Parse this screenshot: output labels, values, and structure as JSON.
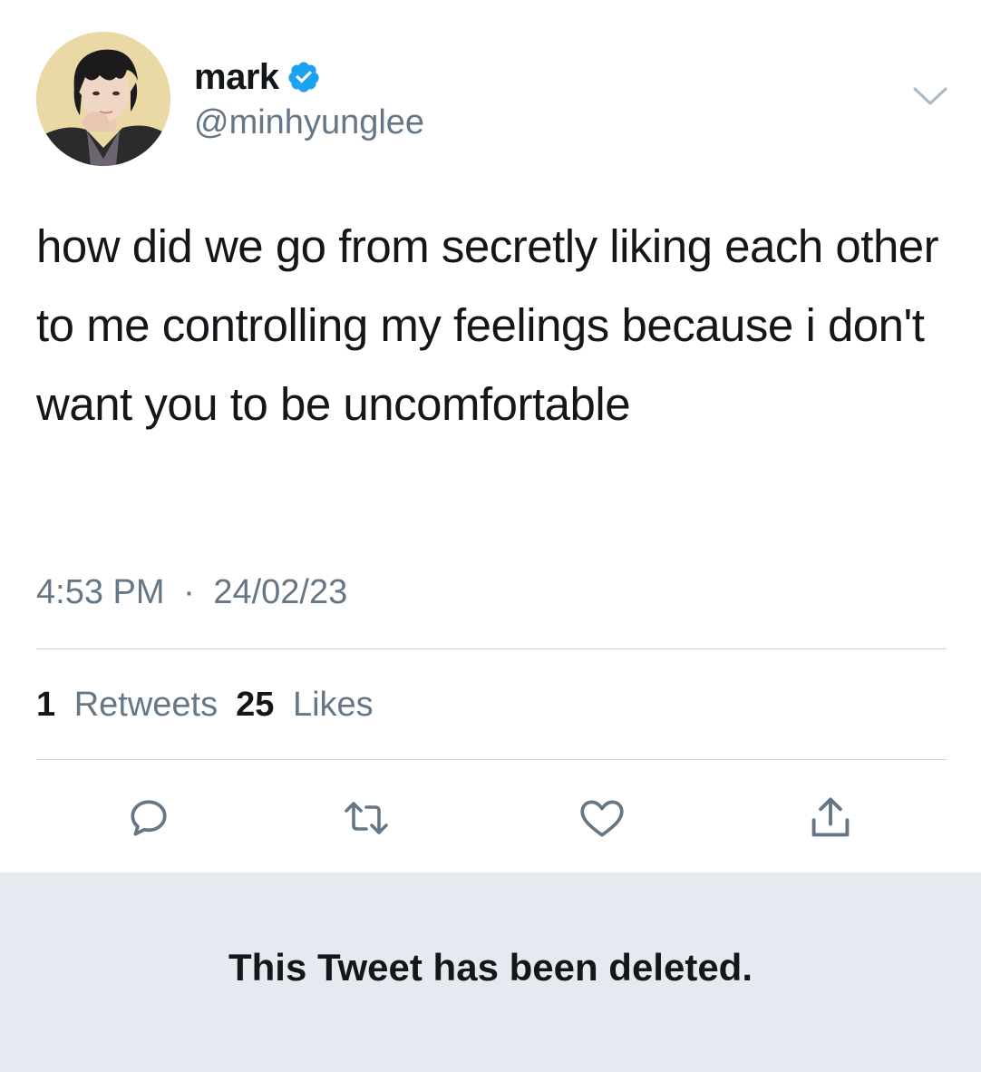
{
  "tweet": {
    "display_name": "mark",
    "handle": "@minhyunglee",
    "text": "how did we go from secretly liking each other to me controlling my feelings because i don't want you to be uncomfortable",
    "time": "4:53 PM",
    "separator": "·",
    "date": "24/02/23",
    "retweets_count": "1",
    "retweets_label": "Retweets",
    "likes_count": "25",
    "likes_label": "Likes"
  },
  "deleted_notice": {
    "text": "This Tweet has been deleted."
  },
  "icons": {
    "verified": "verified-badge-icon",
    "menu": "chevron-down-icon",
    "reply": "reply-icon",
    "retweet": "retweet-icon",
    "like": "heart-icon",
    "share": "share-icon"
  },
  "colors": {
    "accent": "#1da1f2",
    "primary_text": "#14171a",
    "secondary_text": "#657786",
    "icon_gray": "#657786",
    "divider": "#ccd6dd",
    "deleted_bg": "#e6e9ef"
  }
}
